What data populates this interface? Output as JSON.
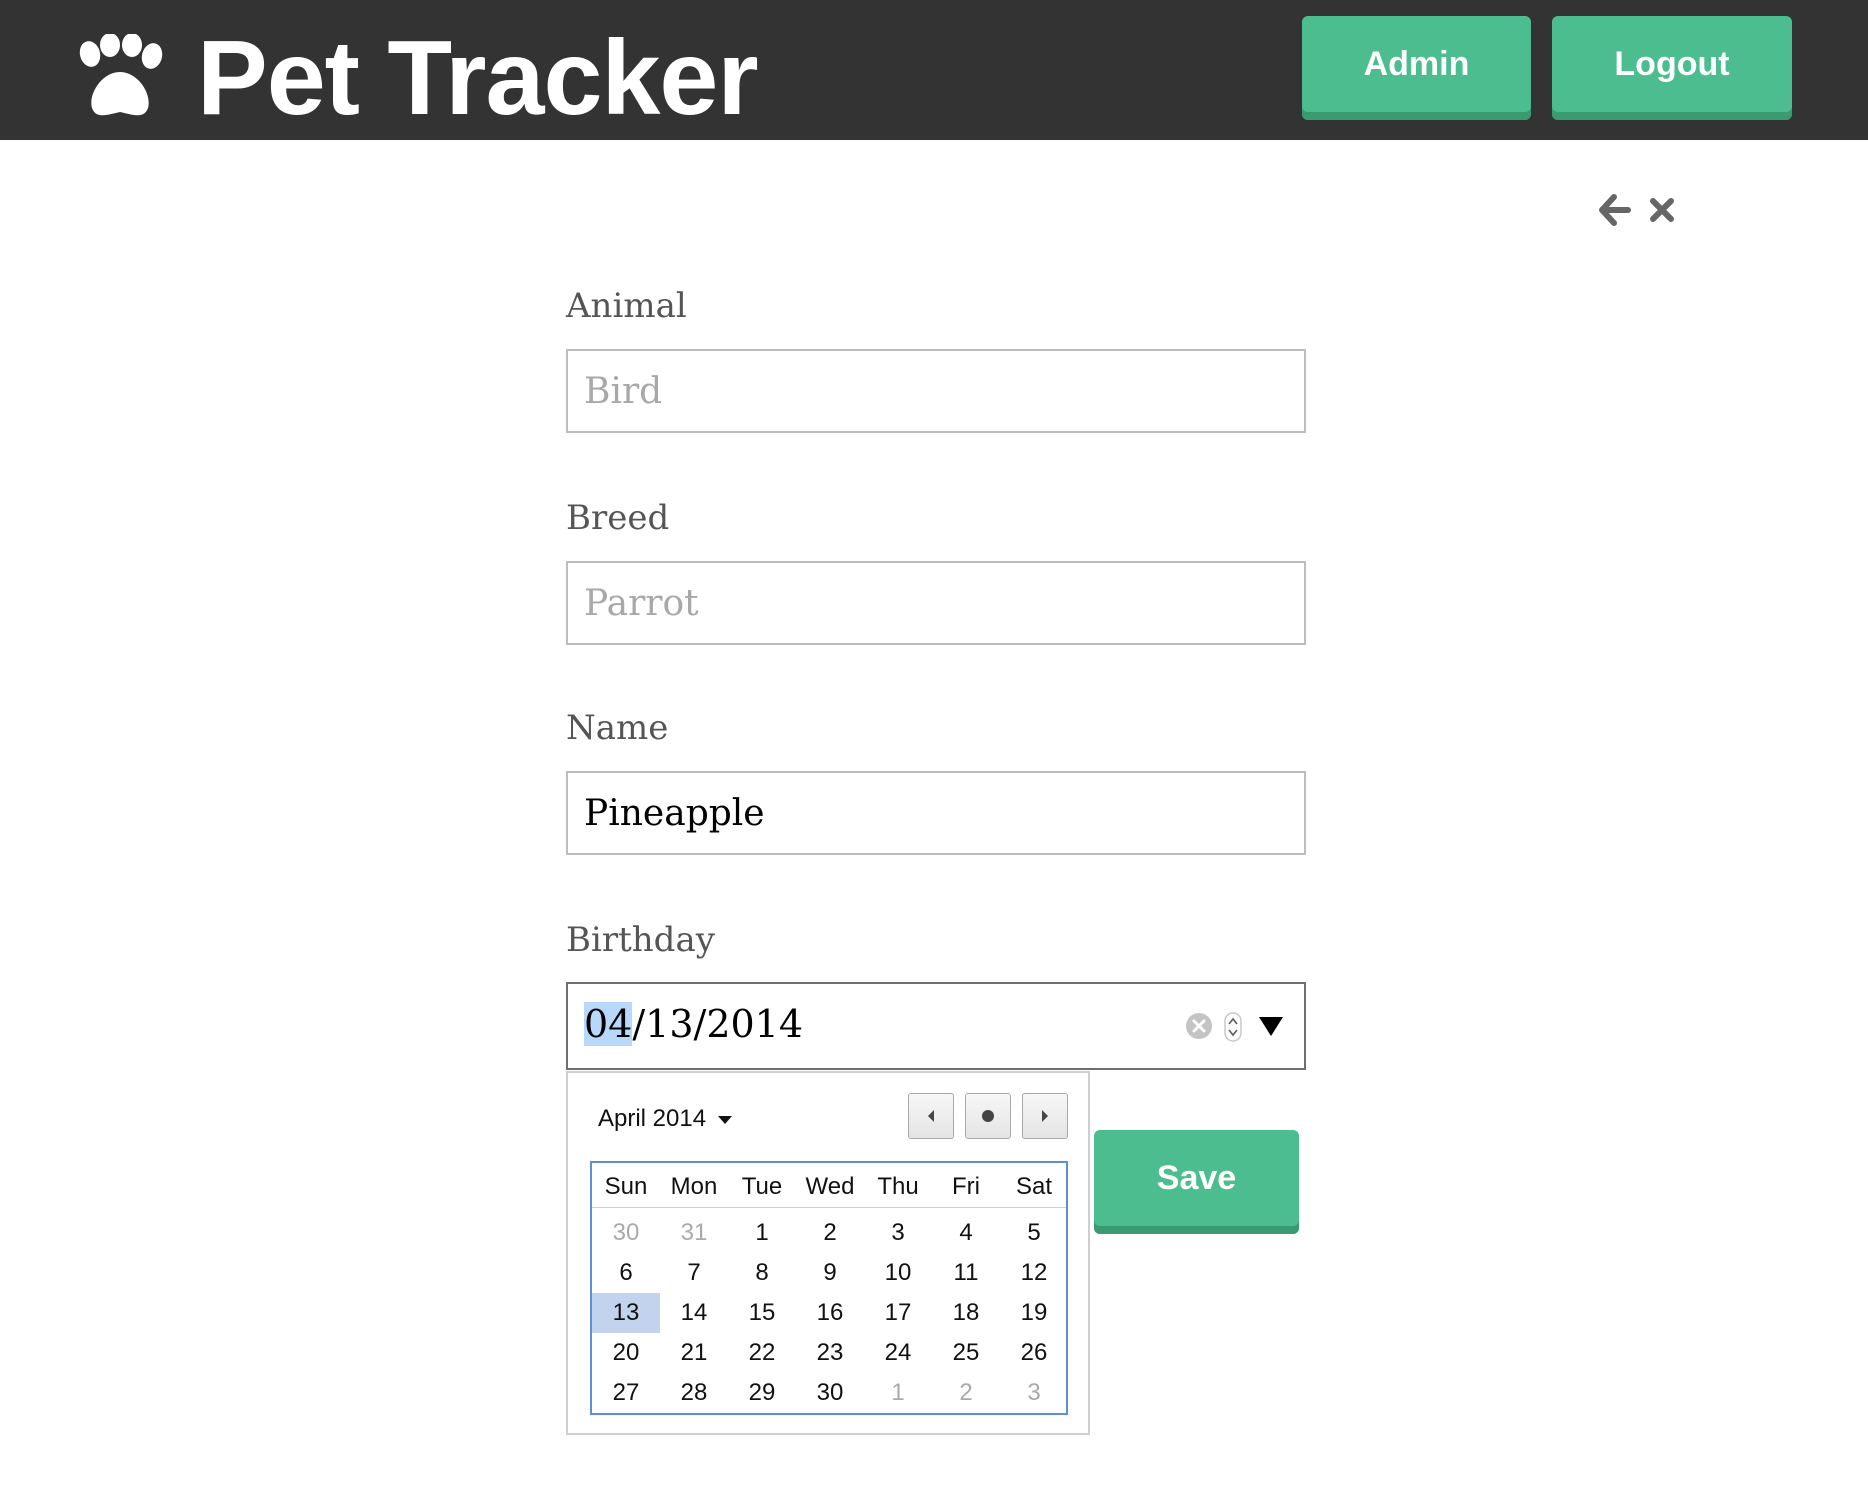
{
  "app": {
    "title": "Pet Tracker",
    "logo_icon": "paw-icon"
  },
  "header": {
    "admin_label": "Admin",
    "logout_label": "Logout"
  },
  "toolbar": {
    "back_icon": "arrow-left-icon",
    "close_icon": "close-icon"
  },
  "form": {
    "animal": {
      "label": "Animal",
      "value": "",
      "placeholder": "Bird"
    },
    "breed": {
      "label": "Breed",
      "value": "",
      "placeholder": "Parrot"
    },
    "name": {
      "label": "Name",
      "value": "Pineapple",
      "placeholder": ""
    },
    "birthday": {
      "label": "Birthday",
      "month": "04",
      "rest": "/13/2014"
    },
    "save_label": "Save"
  },
  "calendar": {
    "month_label": "April 2014",
    "weekdays": [
      "Sun",
      "Mon",
      "Tue",
      "Wed",
      "Thu",
      "Fri",
      "Sat"
    ],
    "weeks": [
      [
        {
          "d": "30",
          "o": true
        },
        {
          "d": "31",
          "o": true
        },
        {
          "d": "1"
        },
        {
          "d": "2"
        },
        {
          "d": "3"
        },
        {
          "d": "4"
        },
        {
          "d": "5"
        }
      ],
      [
        {
          "d": "6"
        },
        {
          "d": "7"
        },
        {
          "d": "8"
        },
        {
          "d": "9"
        },
        {
          "d": "10"
        },
        {
          "d": "11"
        },
        {
          "d": "12"
        }
      ],
      [
        {
          "d": "13",
          "s": true
        },
        {
          "d": "14"
        },
        {
          "d": "15"
        },
        {
          "d": "16"
        },
        {
          "d": "17"
        },
        {
          "d": "18"
        },
        {
          "d": "19"
        }
      ],
      [
        {
          "d": "20"
        },
        {
          "d": "21"
        },
        {
          "d": "22"
        },
        {
          "d": "23"
        },
        {
          "d": "24"
        },
        {
          "d": "25"
        },
        {
          "d": "26"
        }
      ],
      [
        {
          "d": "27"
        },
        {
          "d": "28"
        },
        {
          "d": "29"
        },
        {
          "d": "30"
        },
        {
          "d": "1",
          "o": true
        },
        {
          "d": "2",
          "o": true
        },
        {
          "d": "3",
          "o": true
        }
      ]
    ]
  },
  "colors": {
    "header_bg": "#333333",
    "accent": "#4cbd8f",
    "selected_day": "#c3d3ee"
  }
}
